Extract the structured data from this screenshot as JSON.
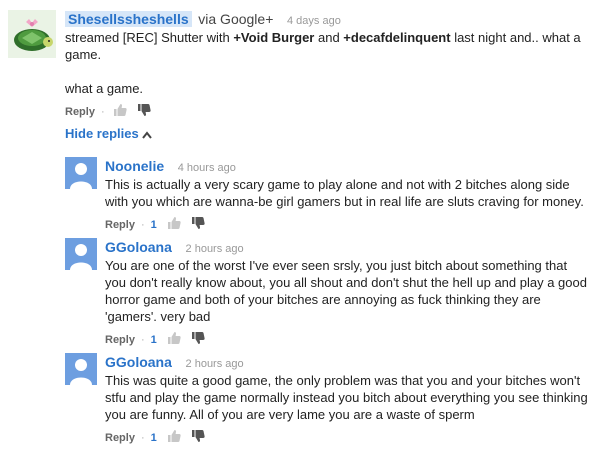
{
  "comments": [
    {
      "author": "Shesellssheshells",
      "via": "via Google+",
      "time": "4 days ago",
      "text_parts": [
        "streamed [REC] Shutter with ",
        "+Void Burger",
        " and ",
        "+decafdelinquent",
        " last night and.. what a game."
      ],
      "text2": "what a game.",
      "reply_label": "Reply",
      "dot": "·"
    },
    {
      "author": "Noonelie",
      "time": "4 hours ago",
      "text": "This is actually a very scary game to play alone and not with 2 bitches along side with you which are wanna-be girl gamers but in real life are sluts craving for money.",
      "reply_label": "Reply",
      "dot": "·",
      "likes": "1"
    },
    {
      "author": "GGoloana",
      "time": "2 hours ago",
      "text": "You are one of the worst I've ever seen srsly, you just bitch about something that you don't really know about, you all shout and don't shut the hell up and play a good horror game and both of your bitches are annoying as fuck thinking they are 'gamers'. very bad",
      "reply_label": "Reply",
      "dot": "·",
      "likes": "1"
    },
    {
      "author": "GGoloana",
      "time": "2 hours ago",
      "text": "This was quite a good game, the only problem was that you and your bitches won't stfu and play the game normally instead you bitch about everything you see thinking you are funny. All of you are very lame you are a waste of sperm",
      "reply_label": "Reply",
      "dot": "·",
      "likes": "1"
    }
  ],
  "hide_replies_label": "Hide replies",
  "icons": {
    "like": "thumbs-up-icon",
    "dislike": "thumbs-down-icon",
    "toggle": "chevron-up-icon",
    "avatar_main": "turtle-avatar",
    "avatar_default": "default-user-avatar"
  },
  "colors": {
    "link": "#2a73c9",
    "author_highlight": "#d6e6f8",
    "avatar_default_bg": "#6d9ee0"
  }
}
